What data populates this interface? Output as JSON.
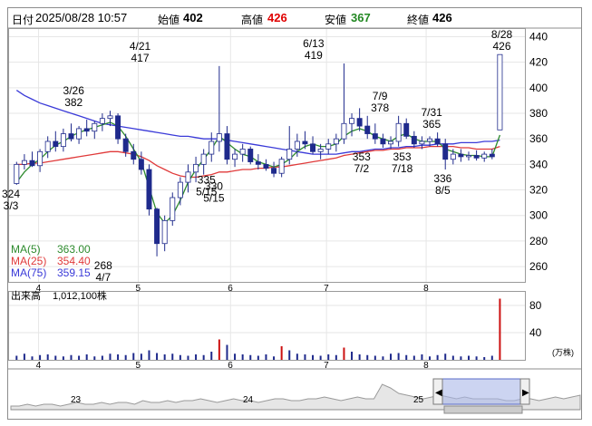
{
  "header": {
    "date_label": "日付",
    "datetime": "2025/08/28 10:57",
    "open_label": "始値",
    "open_value": "402",
    "high_label": "高値",
    "high_value": "426",
    "low_label": "安値",
    "low_value": "367",
    "close_label": "終値",
    "close_value": "426"
  },
  "colors": {
    "up": "#ffffff",
    "down": "#1f2a8c",
    "ma5": "#2e8b2e",
    "ma25": "#e03a3a",
    "ma75": "#3a3ad8",
    "high_value": "#e00000",
    "low_value": "#228822",
    "volume_bar": "#cc1111"
  },
  "ma_legend": [
    {
      "label": "MA(5)",
      "value": "363.00",
      "color": "#2e8b2e"
    },
    {
      "label": "MA(25)",
      "value": "354.40",
      "color": "#e03a3a"
    },
    {
      "label": "MA(75)",
      "value": "359.15",
      "color": "#3a3ad8"
    }
  ],
  "volume_header": {
    "label": "出来高",
    "value": "1,012,100株"
  },
  "volume_unit": "(万株)",
  "chart_data": {
    "type": "candlestick",
    "price_axis": {
      "ticks": [
        260,
        280,
        300,
        320,
        340,
        360,
        380,
        400,
        420,
        440
      ],
      "range": [
        248,
        446
      ]
    },
    "volume_axis": {
      "ticks": [
        40,
        80
      ],
      "range": [
        0,
        100
      ],
      "unit": "(万株)"
    },
    "x_range": [
      0,
      100
    ],
    "month_ticks": [
      {
        "label": "4",
        "x": 8
      },
      {
        "label": "5",
        "x": 35
      },
      {
        "label": "6",
        "x": 60
      },
      {
        "label": "7",
        "x": 86
      },
      {
        "label": "8",
        "x": 113
      }
    ],
    "annotations": [
      {
        "date": "3/3",
        "value": "324",
        "x": 0,
        "y": 324
      },
      {
        "date": "3/26",
        "value": "382",
        "x": 17,
        "y": 382
      },
      {
        "date": "4/7",
        "value": "268",
        "x": 25,
        "y": 268
      },
      {
        "date": "4/21",
        "value": "417",
        "x": 35,
        "y": 417
      },
      {
        "date": "5/15",
        "value": "335",
        "x": 53,
        "y": 335
      },
      {
        "date": "5/15",
        "value": "330",
        "x": 55,
        "y": 330
      },
      {
        "date": "6/13",
        "value": "419",
        "x": 82,
        "y": 419
      },
      {
        "date": "7/2",
        "value": "353",
        "x": 95,
        "y": 353
      },
      {
        "date": "7/9",
        "value": "378",
        "x": 100,
        "y": 378
      },
      {
        "date": "7/18",
        "value": "353",
        "x": 106,
        "y": 353
      },
      {
        "date": "7/31",
        "value": "365",
        "x": 114,
        "y": 365
      },
      {
        "date": "8/5",
        "value": "336",
        "x": 117,
        "y": 336
      },
      {
        "date": "8/28",
        "value": "426",
        "x": 133,
        "y": 426
      }
    ],
    "navigator_labels": [
      "23",
      "24",
      "25"
    ],
    "candles": [
      {
        "o": 325,
        "h": 342,
        "l": 324,
        "c": 340
      },
      {
        "o": 340,
        "h": 348,
        "l": 336,
        "c": 343
      },
      {
        "o": 343,
        "h": 350,
        "l": 338,
        "c": 339
      },
      {
        "o": 339,
        "h": 352,
        "l": 334,
        "c": 350
      },
      {
        "o": 350,
        "h": 362,
        "l": 345,
        "c": 358
      },
      {
        "o": 358,
        "h": 366,
        "l": 350,
        "c": 354
      },
      {
        "o": 354,
        "h": 368,
        "l": 350,
        "c": 364
      },
      {
        "o": 364,
        "h": 372,
        "l": 358,
        "c": 360
      },
      {
        "o": 360,
        "h": 370,
        "l": 356,
        "c": 368
      },
      {
        "o": 368,
        "h": 375,
        "l": 362,
        "c": 366
      },
      {
        "o": 366,
        "h": 374,
        "l": 360,
        "c": 372
      },
      {
        "o": 372,
        "h": 380,
        "l": 366,
        "c": 376
      },
      {
        "o": 376,
        "h": 382,
        "l": 370,
        "c": 378
      },
      {
        "o": 378,
        "h": 380,
        "l": 356,
        "c": 360
      },
      {
        "o": 360,
        "h": 364,
        "l": 346,
        "c": 350
      },
      {
        "o": 350,
        "h": 356,
        "l": 340,
        "c": 344
      },
      {
        "o": 344,
        "h": 350,
        "l": 332,
        "c": 336
      },
      {
        "o": 336,
        "h": 340,
        "l": 300,
        "c": 305
      },
      {
        "o": 305,
        "h": 306,
        "l": 268,
        "c": 278
      },
      {
        "o": 278,
        "h": 300,
        "l": 272,
        "c": 296
      },
      {
        "o": 296,
        "h": 318,
        "l": 292,
        "c": 314
      },
      {
        "o": 314,
        "h": 330,
        "l": 308,
        "c": 326
      },
      {
        "o": 326,
        "h": 340,
        "l": 318,
        "c": 334
      },
      {
        "o": 334,
        "h": 346,
        "l": 326,
        "c": 340
      },
      {
        "o": 340,
        "h": 352,
        "l": 332,
        "c": 348
      },
      {
        "o": 348,
        "h": 365,
        "l": 342,
        "c": 358
      },
      {
        "o": 358,
        "h": 417,
        "l": 350,
        "c": 364
      },
      {
        "o": 364,
        "h": 370,
        "l": 340,
        "c": 344
      },
      {
        "o": 344,
        "h": 352,
        "l": 338,
        "c": 348
      },
      {
        "o": 348,
        "h": 356,
        "l": 342,
        "c": 352
      },
      {
        "o": 352,
        "h": 354,
        "l": 340,
        "c": 342
      },
      {
        "o": 342,
        "h": 348,
        "l": 336,
        "c": 340
      },
      {
        "o": 340,
        "h": 344,
        "l": 335,
        "c": 337
      },
      {
        "o": 337,
        "h": 342,
        "l": 330,
        "c": 333
      },
      {
        "o": 333,
        "h": 346,
        "l": 330,
        "c": 344
      },
      {
        "o": 344,
        "h": 370,
        "l": 340,
        "c": 352
      },
      {
        "o": 352,
        "h": 364,
        "l": 346,
        "c": 358
      },
      {
        "o": 358,
        "h": 366,
        "l": 352,
        "c": 356
      },
      {
        "o": 356,
        "h": 362,
        "l": 348,
        "c": 350
      },
      {
        "o": 350,
        "h": 356,
        "l": 344,
        "c": 352
      },
      {
        "o": 352,
        "h": 360,
        "l": 348,
        "c": 356
      },
      {
        "o": 356,
        "h": 364,
        "l": 350,
        "c": 360
      },
      {
        "o": 360,
        "h": 419,
        "l": 356,
        "c": 372
      },
      {
        "o": 372,
        "h": 380,
        "l": 362,
        "c": 376
      },
      {
        "o": 376,
        "h": 384,
        "l": 366,
        "c": 370
      },
      {
        "o": 370,
        "h": 378,
        "l": 360,
        "c": 364
      },
      {
        "o": 364,
        "h": 372,
        "l": 356,
        "c": 360
      },
      {
        "o": 360,
        "h": 364,
        "l": 353,
        "c": 356
      },
      {
        "o": 356,
        "h": 362,
        "l": 352,
        "c": 358
      },
      {
        "o": 358,
        "h": 378,
        "l": 354,
        "c": 372
      },
      {
        "o": 372,
        "h": 376,
        "l": 360,
        "c": 362
      },
      {
        "o": 362,
        "h": 366,
        "l": 353,
        "c": 356
      },
      {
        "o": 356,
        "h": 362,
        "l": 352,
        "c": 358
      },
      {
        "o": 358,
        "h": 362,
        "l": 354,
        "c": 360
      },
      {
        "o": 360,
        "h": 365,
        "l": 354,
        "c": 356
      },
      {
        "o": 356,
        "h": 360,
        "l": 336,
        "c": 344
      },
      {
        "o": 344,
        "h": 352,
        "l": 340,
        "c": 348
      },
      {
        "o": 348,
        "h": 352,
        "l": 342,
        "c": 346
      },
      {
        "o": 346,
        "h": 350,
        "l": 343,
        "c": 347
      },
      {
        "o": 347,
        "h": 351,
        "l": 343,
        "c": 345
      },
      {
        "o": 345,
        "h": 350,
        "l": 342,
        "c": 348
      },
      {
        "o": 348,
        "h": 352,
        "l": 344,
        "c": 346
      },
      {
        "o": 367,
        "h": 426,
        "l": 367,
        "c": 426
      }
    ],
    "volume": [
      6,
      9,
      5,
      7,
      8,
      6,
      5,
      7,
      6,
      8,
      5,
      6,
      9,
      8,
      7,
      10,
      9,
      14,
      10,
      8,
      9,
      7,
      6,
      8,
      7,
      12,
      30,
      22,
      9,
      8,
      7,
      6,
      8,
      5,
      20,
      14,
      9,
      8,
      7,
      6,
      8,
      7,
      18,
      12,
      8,
      7,
      6,
      5,
      9,
      10,
      7,
      6,
      8,
      5,
      7,
      9,
      6,
      5,
      6,
      5,
      4,
      6,
      90
    ],
    "volume_red_index": [
      26,
      34,
      42,
      62
    ],
    "ma5": [
      326,
      334,
      340,
      344,
      350,
      355,
      358,
      362,
      365,
      367,
      369,
      371,
      373,
      370,
      362,
      352,
      342,
      322,
      302,
      294,
      300,
      312,
      326,
      336,
      344,
      352,
      362,
      357,
      352,
      348,
      346,
      342,
      340,
      338,
      340,
      344,
      350,
      354,
      356,
      354,
      354,
      356,
      362,
      366,
      368,
      366,
      362,
      360,
      358,
      362,
      364,
      360,
      358,
      358,
      358,
      352,
      350,
      348,
      347,
      347,
      346,
      346,
      363
    ],
    "ma25": [
      340,
      340,
      341,
      341,
      342,
      343,
      344,
      345,
      346,
      347,
      348,
      349,
      350,
      350,
      349,
      348,
      346,
      343,
      339,
      336,
      333,
      331,
      330,
      330,
      331,
      332,
      334,
      334,
      335,
      336,
      336,
      337,
      337,
      338,
      338,
      339,
      340,
      341,
      342,
      343,
      344,
      345,
      347,
      348,
      349,
      350,
      351,
      351,
      352,
      352,
      353,
      353,
      353,
      354,
      354,
      354,
      354,
      353,
      353,
      352,
      352,
      352,
      354
    ],
    "ma75": [
      398,
      394,
      391,
      388,
      386,
      384,
      382,
      380,
      378,
      376,
      374,
      372,
      371,
      370,
      369,
      368,
      367,
      366,
      365,
      364,
      363,
      362,
      362,
      361,
      360,
      360,
      360,
      359,
      358,
      357,
      356,
      355,
      354,
      353,
      352,
      351,
      350,
      349,
      348,
      348,
      348,
      348,
      349,
      350,
      350,
      351,
      352,
      352,
      353,
      353,
      354,
      354,
      355,
      355,
      356,
      356,
      356,
      357,
      357,
      357,
      358,
      358,
      359
    ],
    "navigator_series": [
      2,
      2,
      3,
      2,
      3,
      3,
      2,
      3,
      4,
      3,
      3,
      4,
      3,
      4,
      4,
      3,
      5,
      4,
      4,
      5,
      4,
      5,
      5,
      6,
      5,
      4,
      5,
      6,
      5,
      5,
      4,
      5,
      6,
      6,
      5,
      5,
      6,
      6,
      7,
      6,
      5,
      6,
      7,
      6,
      6,
      14,
      12,
      9,
      8,
      7,
      6,
      7,
      8,
      7,
      6,
      7,
      6,
      6,
      6,
      6,
      5,
      5,
      6,
      6,
      5,
      6,
      7,
      6,
      7,
      8
    ]
  }
}
